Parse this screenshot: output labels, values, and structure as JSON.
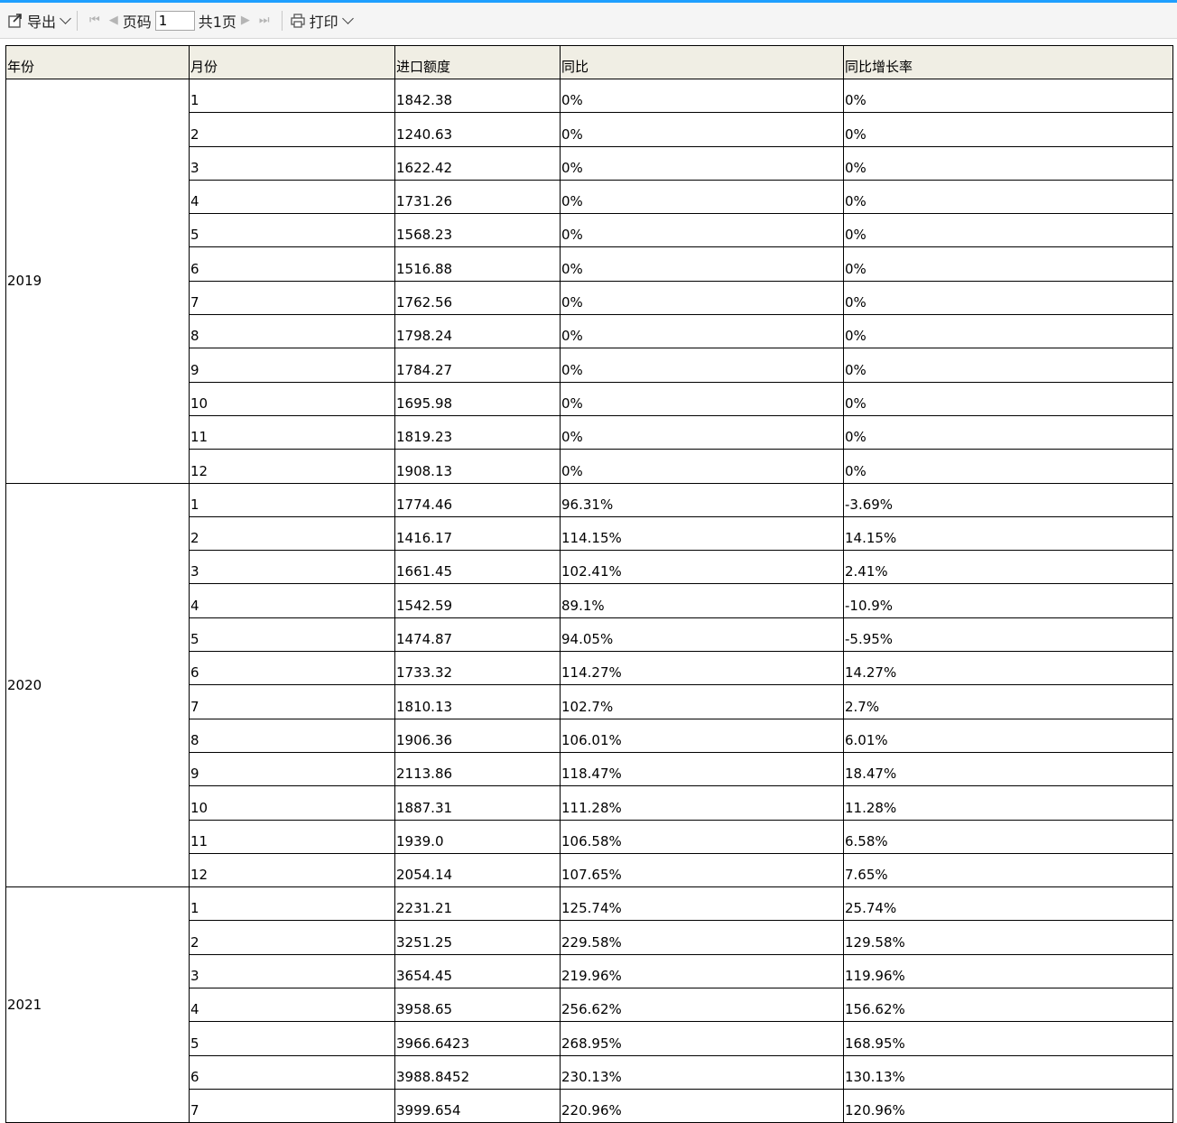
{
  "toolbar": {
    "export_label": "导出",
    "page_label": "页码",
    "page_value": "1",
    "total_label": "共1页",
    "print_label": "打印"
  },
  "table": {
    "headers": [
      "年份",
      "月份",
      "进口额度",
      "同比",
      "同比增长率"
    ],
    "groups": [
      {
        "year": "2019",
        "rows": [
          [
            "1",
            "1842.38",
            "0%",
            "0%"
          ],
          [
            "2",
            "1240.63",
            "0%",
            "0%"
          ],
          [
            "3",
            "1622.42",
            "0%",
            "0%"
          ],
          [
            "4",
            "1731.26",
            "0%",
            "0%"
          ],
          [
            "5",
            "1568.23",
            "0%",
            "0%"
          ],
          [
            "6",
            "1516.88",
            "0%",
            "0%"
          ],
          [
            "7",
            "1762.56",
            "0%",
            "0%"
          ],
          [
            "8",
            "1798.24",
            "0%",
            "0%"
          ],
          [
            "9",
            "1784.27",
            "0%",
            "0%"
          ],
          [
            "10",
            "1695.98",
            "0%",
            "0%"
          ],
          [
            "11",
            "1819.23",
            "0%",
            "0%"
          ],
          [
            "12",
            "1908.13",
            "0%",
            "0%"
          ]
        ]
      },
      {
        "year": "2020",
        "rows": [
          [
            "1",
            "1774.46",
            "96.31%",
            "-3.69%"
          ],
          [
            "2",
            "1416.17",
            "114.15%",
            "14.15%"
          ],
          [
            "3",
            "1661.45",
            "102.41%",
            "2.41%"
          ],
          [
            "4",
            "1542.59",
            "89.1%",
            "-10.9%"
          ],
          [
            "5",
            "1474.87",
            "94.05%",
            "-5.95%"
          ],
          [
            "6",
            "1733.32",
            "114.27%",
            "14.27%"
          ],
          [
            "7",
            "1810.13",
            "102.7%",
            "2.7%"
          ],
          [
            "8",
            "1906.36",
            "106.01%",
            "6.01%"
          ],
          [
            "9",
            "2113.86",
            "118.47%",
            "18.47%"
          ],
          [
            "10",
            "1887.31",
            "111.28%",
            "11.28%"
          ],
          [
            "11",
            "1939.0",
            "106.58%",
            "6.58%"
          ],
          [
            "12",
            "2054.14",
            "107.65%",
            "7.65%"
          ]
        ]
      },
      {
        "year": "2021",
        "rows": [
          [
            "1",
            "2231.21",
            "125.74%",
            "25.74%"
          ],
          [
            "2",
            "3251.25",
            "229.58%",
            "129.58%"
          ],
          [
            "3",
            "3654.45",
            "219.96%",
            "119.96%"
          ],
          [
            "4",
            "3958.65",
            "256.62%",
            "156.62%"
          ],
          [
            "5",
            "3966.6423",
            "268.95%",
            "168.95%"
          ],
          [
            "6",
            "3988.8452",
            "230.13%",
            "130.13%"
          ],
          [
            "7",
            "3999.654",
            "220.96%",
            "120.96%"
          ]
        ]
      }
    ]
  }
}
